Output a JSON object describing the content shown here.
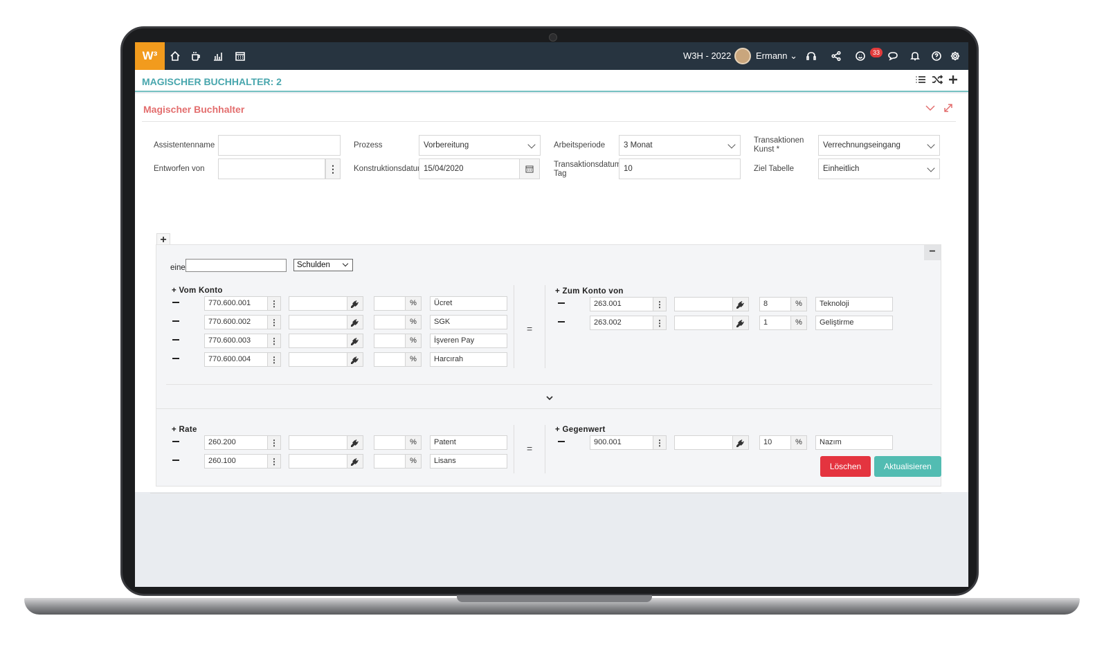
{
  "topbar": {
    "logo": "W³",
    "company": "W3H - 2022",
    "user": "Ermann",
    "notifications_count": "33",
    "icons": [
      "home-icon",
      "coffee-icon",
      "chart-icon",
      "calendar-icon",
      "headset-icon",
      "share-icon",
      "smiley-icon",
      "chat-icon",
      "bell-icon",
      "help-icon",
      "gear-icon"
    ]
  },
  "page": {
    "title": "MAGISCHER BUCHHALTER: 2"
  },
  "panel": {
    "title": "Magischer Buchhalter"
  },
  "form": {
    "assistant_name_label": "Assistentenname",
    "assistant_name_value": "",
    "designed_by_label": "Entworfen von",
    "designed_by_value": "",
    "process_label": "Prozess",
    "process_value": "Vorbereitung",
    "construction_date_label": "Konstruktionsdatum",
    "construction_date_value": "15/04/2020",
    "work_period_label": "Arbeitsperiode",
    "work_period_value": "3 Monat",
    "transaction_date_label": "Transaktionsdatum Tag",
    "transaction_date_value": "10",
    "transactions_art_label": "Transaktionen Kunst *",
    "transactions_art_value": "Verrechnungseingang",
    "target_table_label": "Ziel Tabelle",
    "target_table_value": "Einheitlich"
  },
  "section": {
    "eine_label": "eine",
    "type_select": "Schulden",
    "from_account_label": "Vom Konto",
    "to_account_label": "Zum Konto von",
    "rate_label": "Rate",
    "counter_label": "Gegenwert",
    "equals": "=",
    "percent": "%",
    "from_rows": [
      {
        "account": "770.600.001",
        "pct": "",
        "desc": "Ücret"
      },
      {
        "account": "770.600.002",
        "pct": "",
        "desc": "SGK"
      },
      {
        "account": "770.600.003",
        "pct": "",
        "desc": "İşveren Pay"
      },
      {
        "account": "770.600.004",
        "pct": "",
        "desc": "Harcırah"
      }
    ],
    "to_rows": [
      {
        "account": "263.001",
        "pct": "8",
        "desc": "Teknoloji"
      },
      {
        "account": "263.002",
        "pct": "1",
        "desc": "Geliştirme"
      }
    ],
    "rate_rows": [
      {
        "account": "260.200",
        "pct": "",
        "desc": "Patent"
      },
      {
        "account": "260.100",
        "pct": "",
        "desc": "Lisans"
      }
    ],
    "counter_rows": [
      {
        "account": "900.001",
        "pct": "10",
        "desc": "Nazım"
      }
    ]
  },
  "actions": {
    "delete": "Löschen",
    "update": "Aktualisieren",
    "delete_color": "#e4343f",
    "update_color": "#52bcb2"
  }
}
